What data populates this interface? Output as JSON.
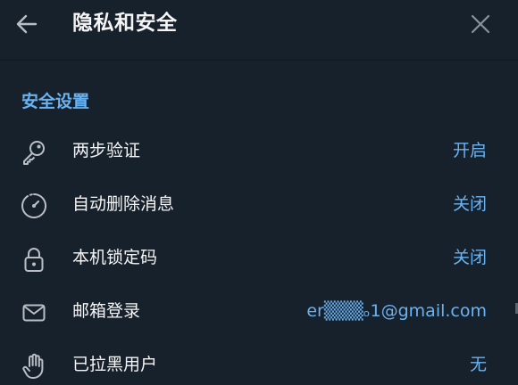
{
  "header": {
    "title": "隐私和安全",
    "back_icon": "arrow-left-icon",
    "close_icon": "close-icon"
  },
  "section": {
    "title": "安全设置"
  },
  "rows": [
    {
      "label": "两步验证",
      "value": "开启",
      "icon": "key-icon"
    },
    {
      "label": "自动删除消息",
      "value": "关闭",
      "icon": "timer-icon"
    },
    {
      "label": "本机锁定码",
      "value": "关闭",
      "icon": "lock-icon"
    },
    {
      "label": "邮箱登录",
      "value": "er▒▒▒ₒ1@gmail.com",
      "icon": "mail-icon"
    },
    {
      "label": "已拉黑用户",
      "value": "无",
      "icon": "hand-icon"
    }
  ],
  "colors": {
    "background": "#17212b",
    "accent": "#6ab3f3",
    "text": "#f5f5f5",
    "icon": "#b9bec4"
  }
}
